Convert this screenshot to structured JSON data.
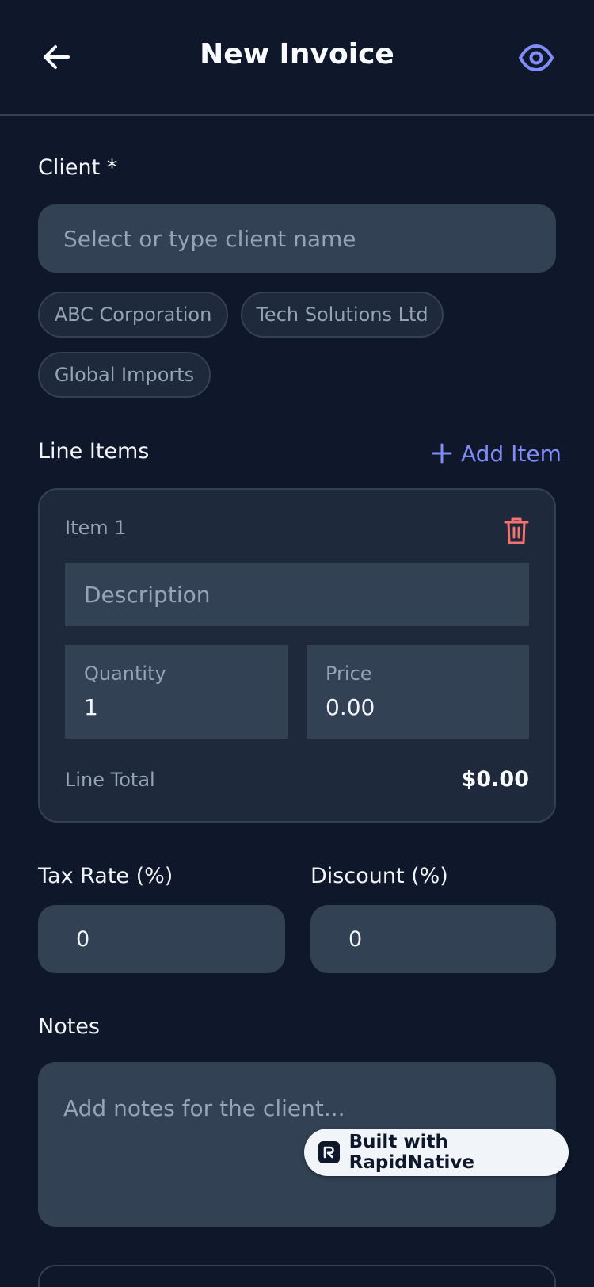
{
  "header": {
    "title": "New Invoice",
    "back_icon": "arrow-left-icon",
    "preview_icon": "eye-icon"
  },
  "client": {
    "label": "Client *",
    "placeholder": "Select or type client name",
    "suggestions": [
      "ABC Corporation",
      "Tech Solutions Ltd",
      "Global Imports"
    ]
  },
  "line_items": {
    "label": "Line Items",
    "add_label": "Add Item",
    "items": [
      {
        "title": "Item 1",
        "description_placeholder": "Description",
        "quantity_label": "Quantity",
        "quantity_value": "1",
        "price_label": "Price",
        "price_value": "0.00",
        "total_label": "Line Total",
        "total_value": "$0.00"
      }
    ]
  },
  "tax": {
    "label": "Tax Rate (%)",
    "value": "0"
  },
  "discount": {
    "label": "Discount (%)",
    "value": "0"
  },
  "notes": {
    "label": "Notes",
    "placeholder": "Add notes for the client..."
  },
  "badge": {
    "text": "Built with RapidNative"
  },
  "colors": {
    "background": "#0f172a",
    "surface": "#1e293b",
    "input": "#334155",
    "accent": "#818cf8",
    "danger": "#f87171"
  }
}
